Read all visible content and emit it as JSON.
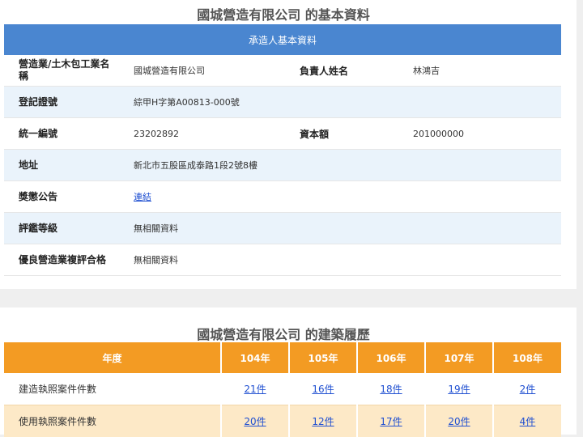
{
  "basic": {
    "title": "國城營造有限公司 的基本資料",
    "header": "承造人基本資料",
    "rows": [
      {
        "label": "營造業/土木包工業名稱",
        "value": "國城營造有限公司",
        "label2": "負責人姓名",
        "value2": "林鴻吉"
      },
      {
        "label": "登記證號",
        "value": "綜甲H字第A00813-000號"
      },
      {
        "label": "統一編號",
        "value": "23202892",
        "label2": "資本額",
        "value2": "201000000"
      },
      {
        "label": "地址",
        "value": "新北市五股區成泰路1段2號8樓"
      },
      {
        "label": "獎懲公告",
        "value": "連結"
      },
      {
        "label": "評鑑等級",
        "value": "無相關資料"
      },
      {
        "label": "優良營造業複評合格",
        "value": "無相關資料"
      }
    ]
  },
  "history": {
    "title": "國城營造有限公司 的建築履歷",
    "headers": [
      "年度",
      "104年",
      "105年",
      "106年",
      "107年",
      "108年"
    ],
    "rows": [
      {
        "label": "建造執照案件件數",
        "cells": [
          "21件",
          "16件",
          "18件",
          "19件",
          "2件"
        ]
      },
      {
        "label": "使用執照案件件數",
        "cells": [
          "20件",
          "12件",
          "17件",
          "20件",
          "4件"
        ]
      }
    ]
  }
}
